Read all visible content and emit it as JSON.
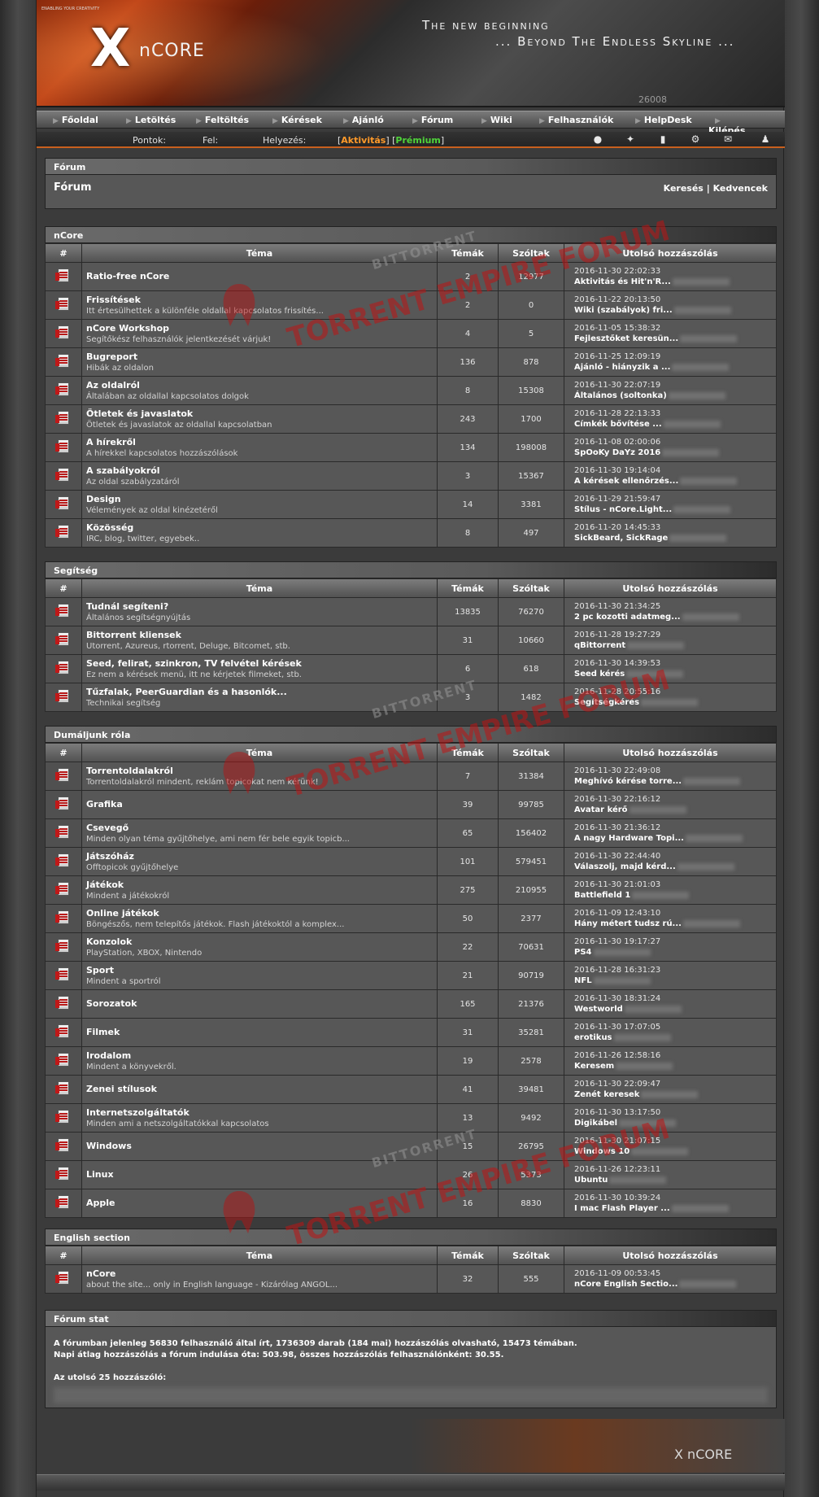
{
  "header": {
    "tiny_title": "ENABLING YOUR CREATIVITY",
    "logo_mark": "X",
    "logo_text": "nCORE",
    "slogan_line1": "The new beginning",
    "slogan_line2": "... Beyond The Endless Skyline ...",
    "code": "26008"
  },
  "nav": {
    "items": [
      "Főoldal",
      "Letöltés",
      "Feltöltés",
      "Kérések",
      "Ajánló",
      "Fórum",
      "Wiki",
      "Felhasználók",
      "HelpDesk"
    ],
    "logout": "Kilépés"
  },
  "status": {
    "points_label": "Pontok:",
    "up_label": "Fel:",
    "rank_label": "Helyezés:",
    "activity": "Aktivitás",
    "premium": "Prémium"
  },
  "forum_box": {
    "header": "Fórum",
    "title": "Fórum",
    "search": "Keresés",
    "sep": "|",
    "favourites": "Kedvencek"
  },
  "columns": {
    "hash": "#",
    "topic": "Téma",
    "topics": "Témák",
    "posts": "Szóltak",
    "last": "Utolsó hozzászólás"
  },
  "sections": [
    {
      "name": "nCore",
      "rows": [
        {
          "title": "Ratio-free nCore",
          "desc": "",
          "topics": "2",
          "posts": "12977",
          "date": "2016-11-30 22:02:33",
          "last": "Aktivitás és Hit'n'R..."
        },
        {
          "title": "Frissítések",
          "desc": "Itt értesülhettek a különféle oldallal kapcsolatos frissítés...",
          "topics": "2",
          "posts": "0",
          "date": "2016-11-22 20:13:50",
          "last": "Wiki (szabályok) fri..."
        },
        {
          "title": "nCore Workshop",
          "desc": "Segítőkész felhasználók jelentkezését várjuk!",
          "topics": "4",
          "posts": "5",
          "date": "2016-11-05 15:38:32",
          "last": "Fejlesztőket keresün..."
        },
        {
          "title": "Bugreport",
          "desc": "Hibák az oldalon",
          "topics": "136",
          "posts": "878",
          "date": "2016-11-25 12:09:19",
          "last": "Ajánló - hiányzik a ..."
        },
        {
          "title": "Az oldalról",
          "desc": "Általában az oldallal kapcsolatos dolgok",
          "topics": "8",
          "posts": "15308",
          "date": "2016-11-30 22:07:19",
          "last": "Általános (soltonka)"
        },
        {
          "title": "Ötletek és javaslatok",
          "desc": "Ötletek és javaslatok az oldallal kapcsolatban",
          "topics": "243",
          "posts": "1700",
          "date": "2016-11-28 22:13:33",
          "last": "Címkék bővítése ..."
        },
        {
          "title": "A hírekről",
          "desc": "A hírekkel kapcsolatos hozzászólások",
          "topics": "134",
          "posts": "198008",
          "date": "2016-11-08 02:00:06",
          "last": "SpOoKy DaYz 2016"
        },
        {
          "title": "A szabályokról",
          "desc": "Az oldal szabályzatáról",
          "topics": "3",
          "posts": "15367",
          "date": "2016-11-30 19:14:04",
          "last": "A kérések ellenőrzés..."
        },
        {
          "title": "Design",
          "desc": "Vélemények az oldal kinézetéről",
          "topics": "14",
          "posts": "3381",
          "date": "2016-11-29 21:59:47",
          "last": "Stílus - nCore.Light..."
        },
        {
          "title": "Közösség",
          "desc": "IRC, blog, twitter, egyebek..",
          "topics": "8",
          "posts": "497",
          "date": "2016-11-20 14:45:33",
          "last": "SickBeard, SickRage"
        }
      ]
    },
    {
      "name": "Segítség",
      "rows": [
        {
          "title": "Tudnál segíteni?",
          "desc": "Általános segítségnyújtás",
          "topics": "13835",
          "posts": "76270",
          "date": "2016-11-30 21:34:25",
          "last": "2 pc kozotti adatmeg..."
        },
        {
          "title": "Bittorrent kliensek",
          "desc": "Utorrent, Azureus, rtorrent, Deluge, Bitcomet, stb.",
          "topics": "31",
          "posts": "10660",
          "date": "2016-11-28 19:27:29",
          "last": "qBittorrent"
        },
        {
          "title": "Seed, felirat, szinkron, TV felvétel kérések",
          "desc": "Ez nem a kérések menü, itt ne kérjetek filmeket, stb.",
          "topics": "6",
          "posts": "618",
          "date": "2016-11-30 14:39:53",
          "last": "Seed kérés"
        },
        {
          "title": "Tűzfalak, PeerGuardian és a hasonlók...",
          "desc": "Technikai segítség",
          "topics": "3",
          "posts": "1482",
          "date": "2016-11-28 20:55:16",
          "last": "Segítségkérés"
        }
      ]
    },
    {
      "name": "Dumáljunk róla",
      "rows": [
        {
          "title": "Torrentoldalakról",
          "desc": "Torrentoldalakról mindent, reklám topicokat nem kérünk!",
          "topics": "7",
          "posts": "31384",
          "date": "2016-11-30 22:49:08",
          "last": "Meghívó kérése torre..."
        },
        {
          "title": "Grafika",
          "desc": "",
          "topics": "39",
          "posts": "99785",
          "date": "2016-11-30 22:16:12",
          "last": "Avatar kérő"
        },
        {
          "title": "Csevegő",
          "desc": "Minden olyan téma gyűjtőhelye, ami nem fér bele egyik topicb...",
          "topics": "65",
          "posts": "156402",
          "date": "2016-11-30 21:36:12",
          "last": "A nagy Hardware Topi..."
        },
        {
          "title": "Játszóház",
          "desc": "Offtopicok gyűjtőhelye",
          "topics": "101",
          "posts": "579451",
          "date": "2016-11-30 22:44:40",
          "last": "Válaszolj, majd kérd..."
        },
        {
          "title": "Játékok",
          "desc": "Mindent a játékokról",
          "topics": "275",
          "posts": "210955",
          "date": "2016-11-30 21:01:03",
          "last": "Battlefield 1"
        },
        {
          "title": "Online játékok",
          "desc": "Böngészős, nem telepítős játékok. Flash játékoktól a komplex...",
          "topics": "50",
          "posts": "2377",
          "date": "2016-11-09 12:43:10",
          "last": "Hány métert tudsz rú..."
        },
        {
          "title": "Konzolok",
          "desc": "PlayStation, XBOX, Nintendo",
          "topics": "22",
          "posts": "70631",
          "date": "2016-11-30 19:17:27",
          "last": "PS4"
        },
        {
          "title": "Sport",
          "desc": "Mindent a sportról",
          "topics": "21",
          "posts": "90719",
          "date": "2016-11-28 16:31:23",
          "last": "NFL"
        },
        {
          "title": "Sorozatok",
          "desc": "",
          "topics": "165",
          "posts": "21376",
          "date": "2016-11-30 18:31:24",
          "last": "Westworld"
        },
        {
          "title": "Filmek",
          "desc": "",
          "topics": "31",
          "posts": "35281",
          "date": "2016-11-30 17:07:05",
          "last": "erotikus"
        },
        {
          "title": "Irodalom",
          "desc": "Mindent a könyvekről.",
          "topics": "19",
          "posts": "2578",
          "date": "2016-11-26 12:58:16",
          "last": "Keresem"
        },
        {
          "title": "Zenei stílusok",
          "desc": "",
          "topics": "41",
          "posts": "39481",
          "date": "2016-11-30 22:09:47",
          "last": "Zenét keresek"
        },
        {
          "title": "Internetszolgáltatók",
          "desc": "Minden ami a netszolgáltatókkal kapcsolatos",
          "topics": "13",
          "posts": "9492",
          "date": "2016-11-30 13:17:50",
          "last": "Digikábel"
        },
        {
          "title": "Windows",
          "desc": "",
          "topics": "15",
          "posts": "26795",
          "date": "2016-11-30 21:07:15",
          "last": "Windows 10"
        },
        {
          "title": "Linux",
          "desc": "",
          "topics": "26",
          "posts": "5373",
          "date": "2016-11-26 12:23:11",
          "last": "Ubuntu"
        },
        {
          "title": "Apple",
          "desc": "",
          "topics": "16",
          "posts": "8830",
          "date": "2016-11-30 10:39:24",
          "last": "I mac Flash Player ..."
        }
      ]
    },
    {
      "name": "English section",
      "rows": [
        {
          "title": "nCore",
          "desc": "about the site... only in English language - Kizárólag ANGOL...",
          "topics": "32",
          "posts": "555",
          "date": "2016-11-09 00:53:45",
          "last": "nCore English Sectio..."
        }
      ]
    }
  ],
  "stats": {
    "header": "Fórum stat",
    "line1": "A fórumban jelenleg 56830 felhasználó által írt, 1736309 darab (184 mai) hozzászólás olvasható, 15473 témában.",
    "line2": "Napi átlag hozzászólás a fórum indulása óta: 503.98, összes hozzászólás felhasználónként: 30.55.",
    "line3": "Az utolsó 25 hozzászóló:"
  },
  "watermark": {
    "main": "TORRENT EMPIRE FORUM",
    "sub": "BITTORRENT"
  },
  "footer": {
    "logo": "X nCORE"
  },
  "icons": {
    "status": [
      "warning-icon",
      "runner-icon",
      "book-icon",
      "settings-icon",
      "messages-icon",
      "users-icon"
    ],
    "row": "forum-document-icon"
  }
}
